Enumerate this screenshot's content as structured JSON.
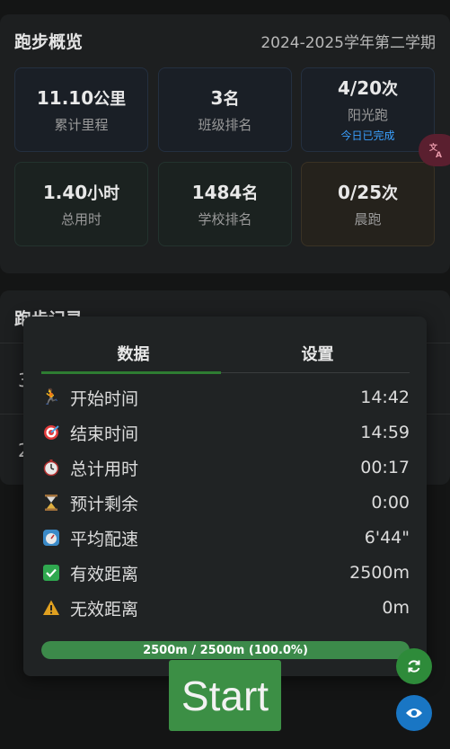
{
  "overview": {
    "title": "跑步概览",
    "semester": "2024-2025学年第二学期",
    "stats": [
      {
        "value": "11.10",
        "unit": "公里",
        "label": "累计里程"
      },
      {
        "value": "3",
        "unit": "名",
        "label": "班级排名"
      },
      {
        "value": "4/20",
        "unit": "次",
        "label": "阳光跑",
        "note": "今日已完成"
      },
      {
        "value": "1.40",
        "unit": "小时",
        "label": "总用时"
      },
      {
        "value": "1484",
        "unit": "名",
        "label": "学校排名"
      },
      {
        "value": "0/25",
        "unit": "次",
        "label": "晨跑"
      }
    ]
  },
  "translate_icon": "translate-icon",
  "records": {
    "title": "跑步记录",
    "row_fragments": [
      "3",
      "2"
    ]
  },
  "panel": {
    "tabs": [
      {
        "label": "数据",
        "active": true
      },
      {
        "label": "设置",
        "active": false
      }
    ],
    "rows": [
      {
        "icon": "runner-icon",
        "glyph": "🏃",
        "label": "开始时间",
        "value": "14:42"
      },
      {
        "icon": "target-icon",
        "glyph": "🎯",
        "label": "结束时间",
        "value": "14:59"
      },
      {
        "icon": "stopwatch-icon",
        "glyph": "⏱",
        "label": "总计用时",
        "value": "00:17"
      },
      {
        "icon": "hourglass-icon",
        "glyph": "⏳",
        "label": "预计剩余",
        "value": "0:00"
      },
      {
        "icon": "speedometer-icon",
        "glyph": "⏲",
        "label": "平均配速",
        "value": "6'44\""
      },
      {
        "icon": "check-icon",
        "glyph": "✔",
        "label": "有效距离",
        "value": "2500m"
      },
      {
        "icon": "warning-icon",
        "glyph": "⚠",
        "label": "无效距离",
        "value": "0m"
      }
    ],
    "progress": {
      "fraction": 1.0,
      "text": "2500m / 2500m (100.0%)"
    }
  },
  "start_button": {
    "label": "Start"
  },
  "fab": {
    "refresh_icon": "refresh-icon",
    "eye_icon": "eye-icon"
  },
  "colors": {
    "accent_green": "#3c8f45",
    "link_blue": "#3aa0ff",
    "eye_blue": "#1976c4"
  }
}
